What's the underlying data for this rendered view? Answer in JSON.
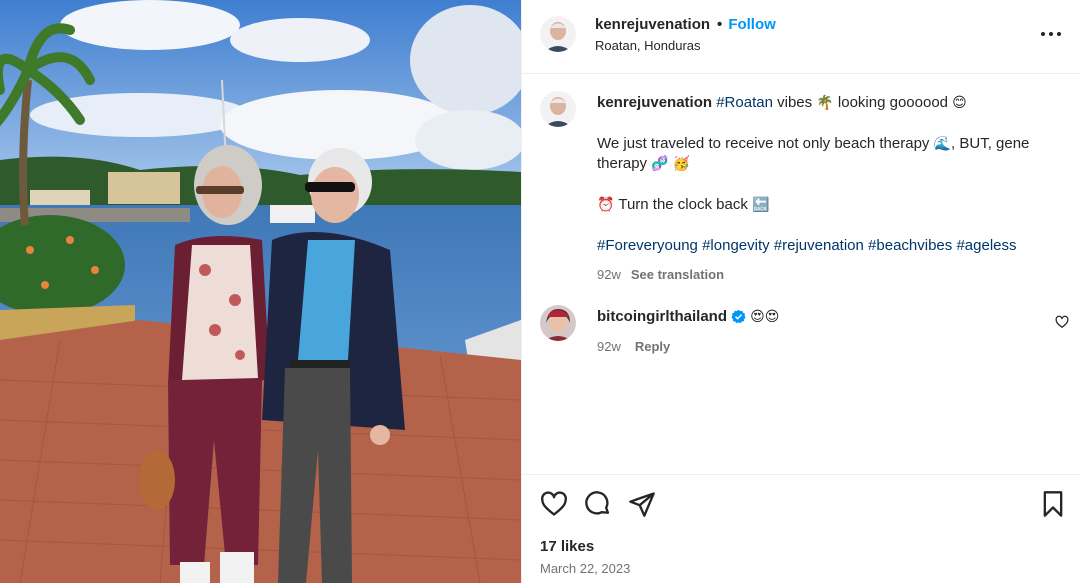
{
  "post": {
    "username": "kenrejuvenation",
    "follow_label": "Follow",
    "dot": "•",
    "location": "Roatan, Honduras"
  },
  "caption": {
    "username": "kenrejuvenation",
    "tag_roatan": "#Roatan",
    "line1_rest": " vibes ",
    "palm_emoji": "🌴",
    "line1_end": " looking goooood ",
    "smile_emoji": "😊",
    "para2_a": "We just traveled to receive not only beach therapy ",
    "wave_emoji": "🌊",
    "para2_b": ", BUT, gene therapy ",
    "dna_emoji": "🧬",
    "party_emoji": "🥳",
    "clock_emoji": "⏰",
    "para3": " Turn the clock back ",
    "back_emoji": "🔙",
    "hashtags": [
      "#Foreveryoung",
      "#longevity",
      "#rejuvenation",
      "#beachvibes",
      "#ageless"
    ],
    "time": "92w",
    "see_translation": "See translation"
  },
  "comment": {
    "username": "bitcoingirlthailand",
    "text": "😍😍",
    "time": "92w",
    "reply": "Reply"
  },
  "footer": {
    "likes": "17 likes",
    "date": "March 22, 2023"
  },
  "icons": {
    "more": "more-options-icon",
    "like": "heart-icon",
    "comment": "comment-icon",
    "share": "share-icon",
    "save": "bookmark-icon",
    "verified": "verified-badge-icon"
  },
  "colors": {
    "link": "#00376b",
    "follow": "#0095f6",
    "muted": "#737373",
    "verified": "#0095f6"
  }
}
